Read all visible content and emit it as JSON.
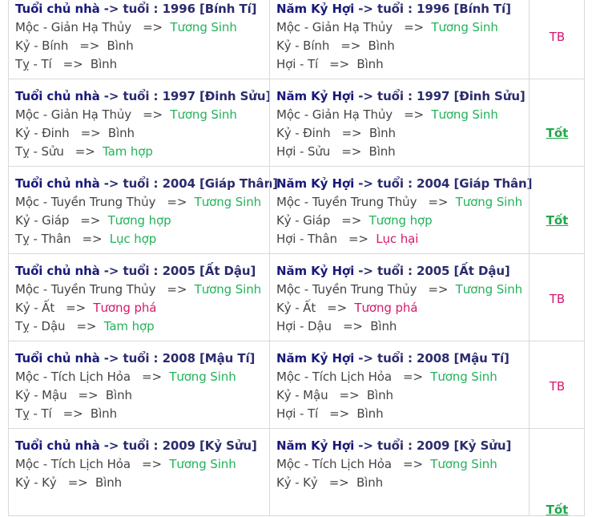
{
  "rows": [
    {
      "owner": {
        "head": "Tuổi chủ nhà",
        "arrow": " -> tuổi : ",
        "year": "1996 [Bính Tí]",
        "lines": [
          {
            "a": "Mộc - Giản Hạ Thủy",
            "sep": "=>",
            "r": "Tương Sinh",
            "t": "good"
          },
          {
            "a": "Kỷ - Bính",
            "sep": "=>",
            "r": "Bình",
            "t": "normal"
          },
          {
            "a": "Tỵ - Tí",
            "sep": "=>",
            "r": "Bình",
            "t": "normal"
          }
        ]
      },
      "year": {
        "head": "Năm Kỷ Hợi",
        "arrow": " -> tuổi : ",
        "year": "1996 [Bính Tí]",
        "lines": [
          {
            "a": "Mộc - Giản Hạ Thủy",
            "sep": "=>",
            "r": "Tương Sinh",
            "t": "good"
          },
          {
            "a": "Kỷ - Bính",
            "sep": "=>",
            "r": "Bình",
            "t": "normal"
          },
          {
            "a": "Hợi - Tí",
            "sep": "=>",
            "r": "Bình",
            "t": "normal"
          }
        ]
      },
      "rating": "TB",
      "rating_type": "tb"
    },
    {
      "owner": {
        "head": "Tuổi chủ nhà",
        "arrow": " -> tuổi : ",
        "year": "1997 [Đinh Sửu]",
        "lines": [
          {
            "a": "Mộc - Giản Hạ Thủy",
            "sep": "=>",
            "r": "Tương Sinh",
            "t": "good"
          },
          {
            "a": "Kỷ - Đinh",
            "sep": "=>",
            "r": "Bình",
            "t": "normal"
          },
          {
            "a": "Tỵ - Sửu",
            "sep": "=>",
            "r": "Tam hợp",
            "t": "good"
          }
        ]
      },
      "year": {
        "head": "Năm Kỷ Hợi",
        "arrow": " -> tuổi : ",
        "year": "1997 [Đinh Sửu]",
        "lines": [
          {
            "a": "Mộc - Giản Hạ Thủy",
            "sep": "=>",
            "r": "Tương Sinh",
            "t": "good"
          },
          {
            "a": "Kỷ - Đinh",
            "sep": "=>",
            "r": "Bình",
            "t": "normal"
          },
          {
            "a": "Hợi - Sửu",
            "sep": "=>",
            "r": "Bình",
            "t": "normal"
          }
        ]
      },
      "rating": "Tốt",
      "rating_type": "tot"
    },
    {
      "owner": {
        "head": "Tuổi chủ nhà",
        "arrow": " -> tuổi : ",
        "year": "2004 [Giáp Thân]",
        "lines": [
          {
            "a": "Mộc - Tuyền Trung Thủy",
            "sep": "=>",
            "r": "Tương Sinh",
            "t": "good"
          },
          {
            "a": "Kỷ - Giáp",
            "sep": "=>",
            "r": "Tương hợp",
            "t": "good"
          },
          {
            "a": "Tỵ - Thân",
            "sep": "=>",
            "r": "Lục hợp",
            "t": "good"
          }
        ]
      },
      "year": {
        "head": "Năm Kỷ Hợi",
        "arrow": " -> tuổi : ",
        "year": "2004 [Giáp Thân]",
        "lines": [
          {
            "a": "Mộc - Tuyền Trung Thủy",
            "sep": "=>",
            "r": "Tương Sinh",
            "t": "good"
          },
          {
            "a": "Kỷ - Giáp",
            "sep": "=>",
            "r": "Tương hợp",
            "t": "good"
          },
          {
            "a": "Hợi - Thân",
            "sep": "=>",
            "r": "Lục hại",
            "t": "bad"
          }
        ]
      },
      "rating": "Tốt",
      "rating_type": "tot"
    },
    {
      "owner": {
        "head": "Tuổi chủ nhà",
        "arrow": " -> tuổi : ",
        "year": "2005 [Ất Dậu]",
        "lines": [
          {
            "a": "Mộc - Tuyền Trung Thủy",
            "sep": "=>",
            "r": "Tương Sinh",
            "t": "good"
          },
          {
            "a": "Kỷ - Ất",
            "sep": "=>",
            "r": "Tương phá",
            "t": "bad"
          },
          {
            "a": "Tỵ - Dậu",
            "sep": "=>",
            "r": "Tam hợp",
            "t": "good"
          }
        ]
      },
      "year": {
        "head": "Năm Kỷ Hợi",
        "arrow": " -> tuổi : ",
        "year": "2005 [Ất Dậu]",
        "lines": [
          {
            "a": "Mộc - Tuyền Trung Thủy",
            "sep": "=>",
            "r": "Tương Sinh",
            "t": "good"
          },
          {
            "a": "Kỷ - Ất",
            "sep": "=>",
            "r": "Tương phá",
            "t": "bad"
          },
          {
            "a": "Hợi - Dậu",
            "sep": "=>",
            "r": "Bình",
            "t": "normal"
          }
        ]
      },
      "rating": "TB",
      "rating_type": "tb"
    },
    {
      "owner": {
        "head": "Tuổi chủ nhà",
        "arrow": " -> tuổi : ",
        "year": "2008 [Mậu Tí]",
        "lines": [
          {
            "a": "Mộc - Tích Lịch Hỏa",
            "sep": "=>",
            "r": "Tương Sinh",
            "t": "good"
          },
          {
            "a": "Kỷ - Mậu",
            "sep": "=>",
            "r": "Bình",
            "t": "normal"
          },
          {
            "a": "Tỵ - Tí",
            "sep": "=>",
            "r": "Bình",
            "t": "normal"
          }
        ]
      },
      "year": {
        "head": "Năm Kỷ Hợi",
        "arrow": " -> tuổi : ",
        "year": "2008 [Mậu Tí]",
        "lines": [
          {
            "a": "Mộc - Tích Lịch Hỏa",
            "sep": "=>",
            "r": "Tương Sinh",
            "t": "good"
          },
          {
            "a": "Kỷ - Mậu",
            "sep": "=>",
            "r": "Bình",
            "t": "normal"
          },
          {
            "a": "Hợi - Tí",
            "sep": "=>",
            "r": "Bình",
            "t": "normal"
          }
        ]
      },
      "rating": "TB",
      "rating_type": "tb"
    },
    {
      "owner": {
        "head": "Tuổi chủ nhà",
        "arrow": " -> tuổi : ",
        "year": "2009 [Kỷ Sửu]",
        "lines": [
          {
            "a": "Mộc - Tích Lịch Hỏa",
            "sep": "=>",
            "r": "Tương Sinh",
            "t": "good"
          },
          {
            "a": "Kỷ - Kỷ",
            "sep": "=>",
            "r": "Bình",
            "t": "normal"
          }
        ]
      },
      "year": {
        "head": "Năm Kỷ Hợi",
        "arrow": " -> tuổi : ",
        "year": "2009 [Kỷ Sửu]",
        "lines": [
          {
            "a": "Mộc - Tích Lịch Hỏa",
            "sep": "=>",
            "r": "Tương Sinh",
            "t": "good"
          },
          {
            "a": "Kỷ - Kỷ",
            "sep": "=>",
            "r": "Bình",
            "t": "normal"
          }
        ]
      },
      "rating": "Tốt",
      "rating_type": "tot"
    }
  ],
  "colors": {
    "heading": "#19197a",
    "good": "#22b35a",
    "bad": "#d6196e",
    "normal": "#444444",
    "border": "#d9d9d9"
  }
}
